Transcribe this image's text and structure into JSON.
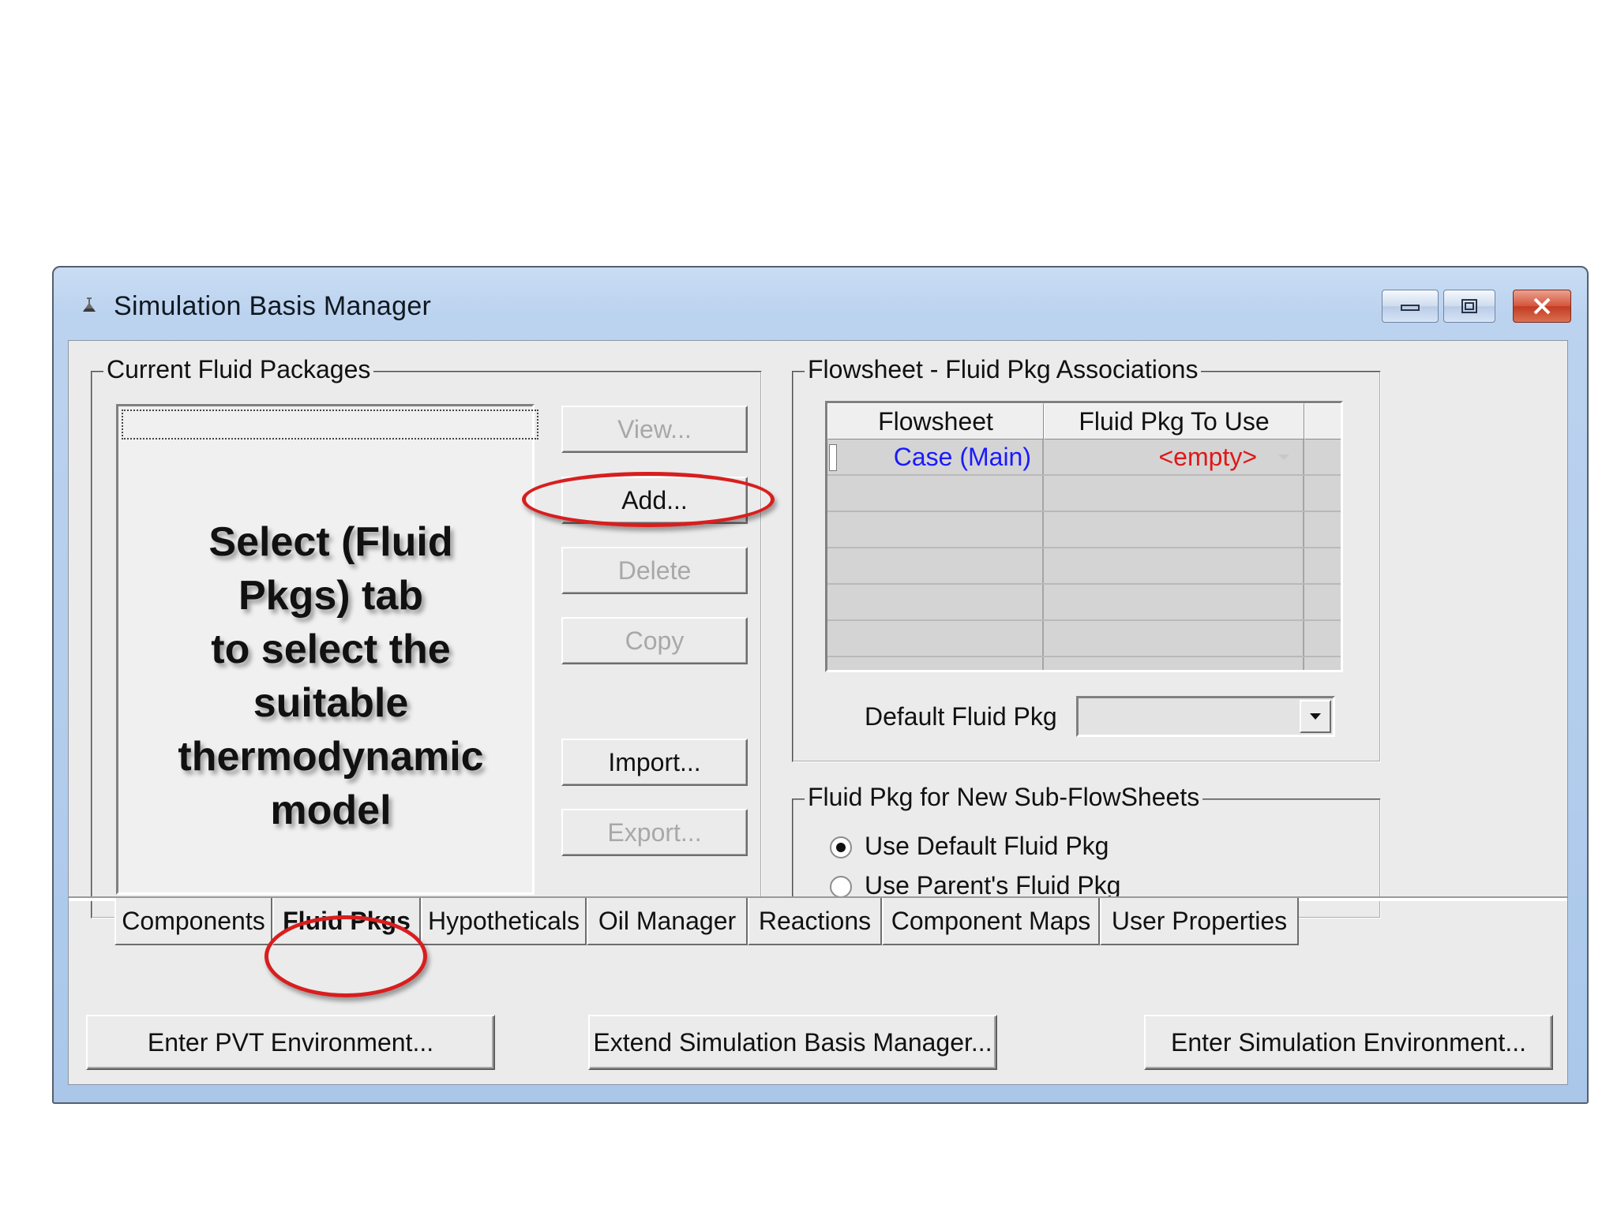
{
  "window": {
    "title": "Simulation Basis Manager"
  },
  "current_fluid_packages": {
    "legend": "Current Fluid Packages",
    "overlay_text_lines": [
      "Select (Fluid",
      "Pkgs) tab",
      "to select the",
      "suitable",
      "thermodynamic",
      "model"
    ],
    "buttons": {
      "view": "View...",
      "add": "Add...",
      "delete": "Delete",
      "copy": "Copy",
      "import": "Import...",
      "export": "Export..."
    }
  },
  "associations": {
    "legend": "Flowsheet - Fluid Pkg Associations",
    "columns": [
      "Flowsheet",
      "Fluid Pkg To Use"
    ],
    "rows": [
      {
        "flowsheet": "Case (Main)",
        "fluid_pkg": "<empty>"
      }
    ],
    "default_label": "Default Fluid Pkg",
    "default_value": ""
  },
  "subflowsheets": {
    "legend": "Fluid Pkg for New Sub-FlowSheets",
    "options": [
      "Use Default Fluid Pkg",
      "Use Parent's Fluid Pkg"
    ],
    "selected": "Use Default Fluid Pkg"
  },
  "tabs": [
    "Components",
    "Fluid Pkgs",
    "Hypotheticals",
    "Oil Manager",
    "Reactions",
    "Component Maps",
    "User Properties"
  ],
  "active_tab": "Fluid Pkgs",
  "bottom_buttons": {
    "pvt": "Enter PVT Environment...",
    "extend": "Extend Simulation Basis Manager...",
    "simulation": "Enter Simulation Environment..."
  },
  "colors": {
    "link_blue": "#1a1aff",
    "empty_red": "#e01818",
    "highlight_red": "#d81e1e"
  }
}
